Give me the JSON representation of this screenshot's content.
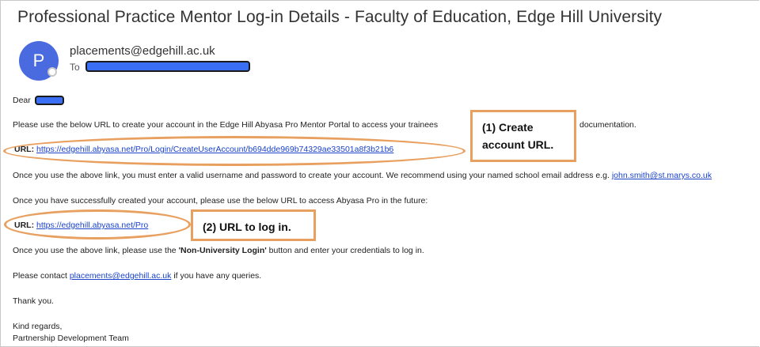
{
  "email": {
    "subject": "Professional Practice Mentor Log-in Details - Faculty of Education, Edge Hill University",
    "avatar_letter": "P",
    "sender": "placements@edgehill.ac.uk",
    "to_label": "To",
    "greeting": "Dear",
    "line1": "Please use the below URL to create your account in the Edge Hill Abyasa Pro Mentor Portal to access your trainees",
    "line1_tail": "documentation.",
    "url1_label": "URL:",
    "url1": "https://edgehill.abyasa.net/Pro/Login/CreateUserAccount/b694dde969b74329ae33501a8f3b21b6",
    "line2": "Once you use the above link, you must enter a valid username and password to create your account. We recommend using your named school email address e.g.",
    "example_email": "john.smith@st.marys.co.uk",
    "line3": "Once you have successfully created your account, please use the below URL to access Abyasa Pro in the future:",
    "url2_label": "URL:",
    "url2": "https://edgehill.abyasa.net/Pro",
    "line4_pre": "Once you use the above link, please use the",
    "line4_bold": "'Non-University Login'",
    "line4_post": "button and enter your credentials to log in.",
    "line5_pre": "Please contact",
    "contact_email": "placements@edgehill.ac.uk",
    "line5_post": "if you have any queries.",
    "thanks": "Thank you.",
    "regards": "Kind regards,",
    "team": "Partnership Development Team"
  },
  "annotations": {
    "callout1_line1": "(1) Create",
    "callout1_line2": "account URL.",
    "callout2": "(2) URL to log in.",
    "color": "#e8a060"
  },
  "colors": {
    "avatar": "#4a6be0",
    "link": "#1a43c9",
    "redaction": "#3a6ef5"
  }
}
